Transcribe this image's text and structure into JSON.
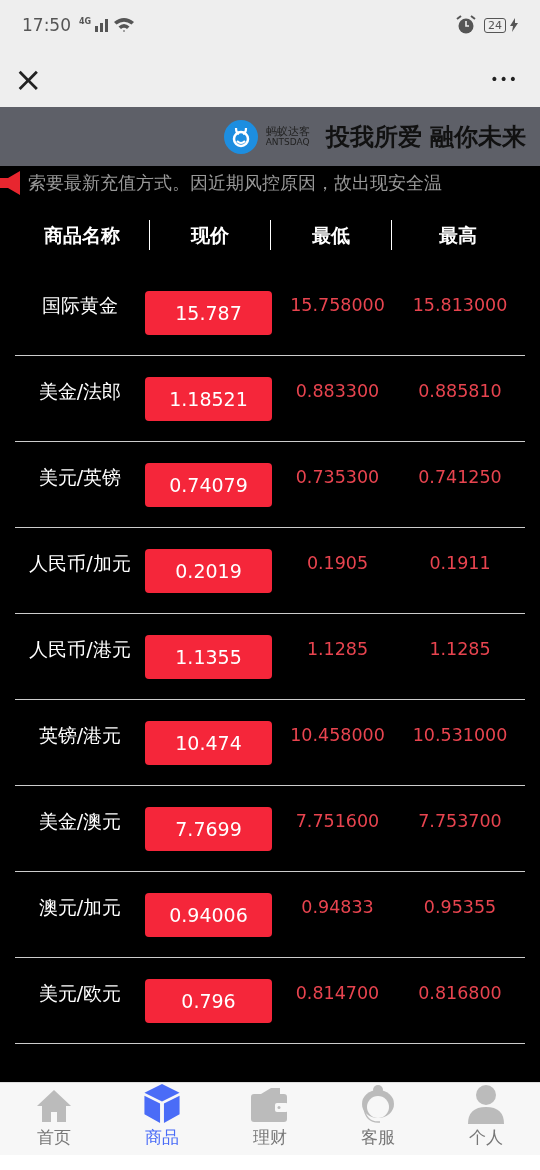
{
  "status_bar": {
    "time": "17:50",
    "network": "4G",
    "battery": "24"
  },
  "top_bar": {
    "close": "×",
    "more": "•••"
  },
  "banner": {
    "brand_cn": "蚂蚁达客",
    "brand_en": "ANTSDAQ",
    "slogan": "投我所爱 融你未来"
  },
  "ticker": {
    "text": "索要最新充值方式。因近期风控原因，故出现安全温"
  },
  "table": {
    "columns": [
      "商品名称",
      "现价",
      "最低",
      "最高"
    ],
    "rows": [
      {
        "name": "国际黄金",
        "price": "15.787",
        "low": "15.758000",
        "high": "15.813000"
      },
      {
        "name": "美金/法郎",
        "price": "1.18521",
        "low": "0.883300",
        "high": "0.885810"
      },
      {
        "name": "美元/英镑",
        "price": "0.74079",
        "low": "0.735300",
        "high": "0.741250"
      },
      {
        "name": "人民币/加元",
        "price": "0.2019",
        "low": "0.1905",
        "high": "0.1911"
      },
      {
        "name": "人民币/港元",
        "price": "1.1355",
        "low": "1.1285",
        "high": "1.1285"
      },
      {
        "name": "英镑/港元",
        "price": "10.474",
        "low": "10.458000",
        "high": "10.531000"
      },
      {
        "name": "美金/澳元",
        "price": "7.7699",
        "low": "7.751600",
        "high": "7.753700"
      },
      {
        "name": "澳元/加元",
        "price": "0.94006",
        "low": "0.94833",
        "high": "0.95355"
      },
      {
        "name": "美元/欧元",
        "price": "0.796",
        "low": "0.814700",
        "high": "0.816800"
      }
    ]
  },
  "tab_bar": [
    {
      "kind": "home",
      "label": "首页",
      "selected": false
    },
    {
      "kind": "goods",
      "label": "商品",
      "selected": true
    },
    {
      "kind": "wallet",
      "label": "理财",
      "selected": false
    },
    {
      "kind": "service",
      "label": "客服",
      "selected": false
    },
    {
      "kind": "person",
      "label": "个人",
      "selected": false
    }
  ]
}
